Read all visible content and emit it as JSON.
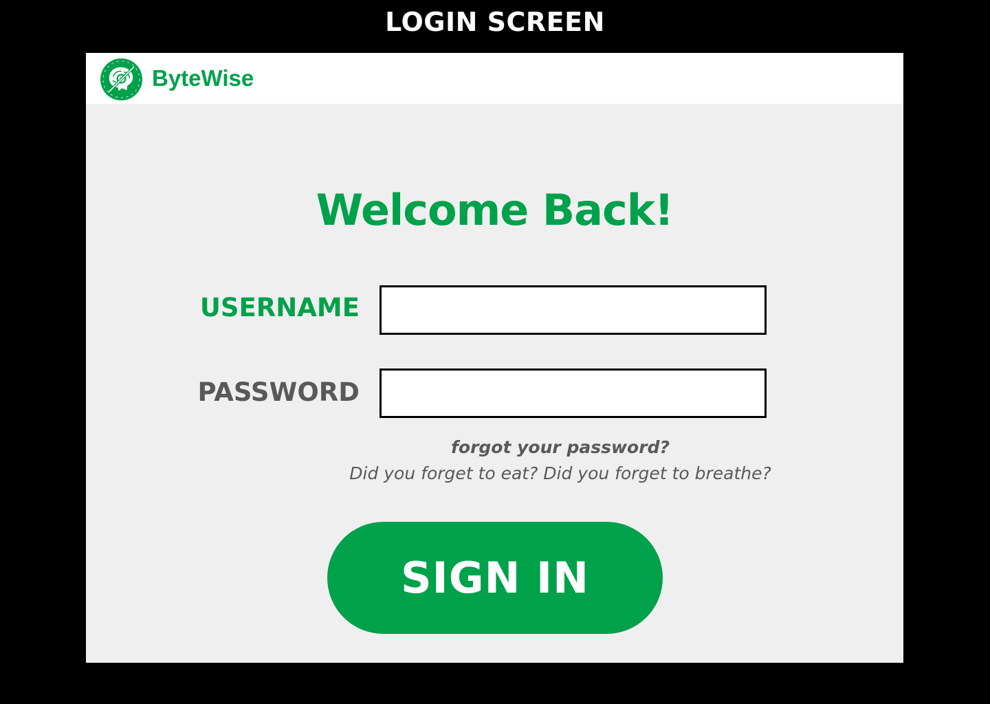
{
  "screen": {
    "title": "LOGIN SCREEN"
  },
  "header": {
    "brand_name": "ByteWise",
    "logo_icon": "brain-chip-logo-icon"
  },
  "login": {
    "welcome": "Welcome Back!",
    "username_label": "USERNAME",
    "username_value": "",
    "password_label": "PASSWORD",
    "password_value": "",
    "forgot_link": "forgot your password?",
    "forgot_subtext": "Did you forget to eat? Did you forget to breathe?",
    "sign_in_label": "SIGN IN"
  },
  "colors": {
    "brand_green": "#00a14b",
    "label_gray": "#595959",
    "page_background": "#000000",
    "panel_background": "#efefef",
    "header_background": "#ffffff"
  }
}
